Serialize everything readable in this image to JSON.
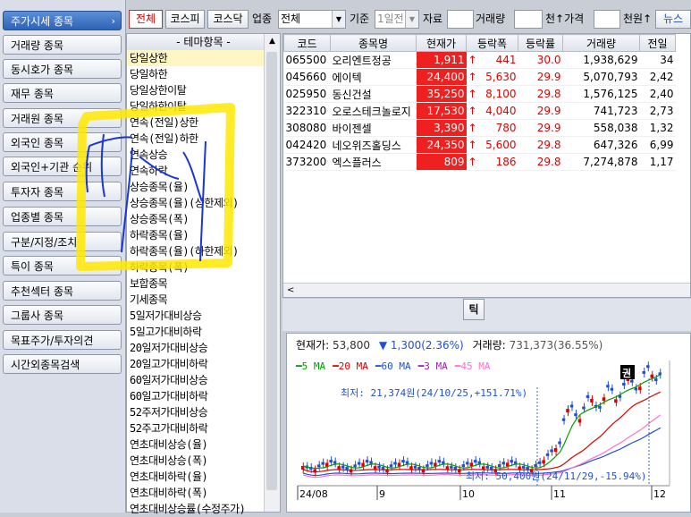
{
  "left_menu": [
    {
      "label": "주가시세 종목",
      "active": true
    },
    {
      "label": "거래량 종목"
    },
    {
      "label": "동시호가 종목"
    },
    {
      "label": "재무 종목"
    },
    {
      "label": "거래원 종목"
    },
    {
      "label": "외국인 종목"
    },
    {
      "label": "외국인+기관 순위"
    },
    {
      "label": "투자자 종목"
    },
    {
      "label": "업종별 종목"
    },
    {
      "label": "구분/지정/조치"
    },
    {
      "label": "특이 종목"
    },
    {
      "label": "추천섹터 종목"
    },
    {
      "label": "그룹사 종목"
    },
    {
      "label": "목표주가/투자의견"
    },
    {
      "label": "시간외종목검색"
    }
  ],
  "menu_arrow": "›",
  "toolbar": {
    "btn_all": "전체",
    "btn_kospi": "코스피",
    "btn_kosdaq": "코스닥",
    "sector_label": "업종",
    "sector_value": "전체",
    "basis_label": "기준",
    "basis_value": "1일전",
    "capital_label": "자료",
    "volume_label": "거래량",
    "volume_unit": "천↑가격",
    "price_unit": "천원↑",
    "news_label": "뉴스"
  },
  "theme": {
    "header": "- 테마항목 -",
    "items": [
      "당일상한",
      "당일하한",
      "당일상한이탈",
      "당일하한이탈",
      "연속(전일)상한",
      "연속(전일)하한",
      "연속상승",
      "연속하락",
      "상승종목(율)",
      "상승종목(율)(상한제외)",
      "상승종목(폭)",
      "하락종목(율)",
      "하락종목(율)(하한제외)",
      "하락종목(폭)",
      "보합종목",
      "기세종목",
      "5일저가대비상승",
      "5일고가대비하락",
      "20일저가대비상승",
      "20일고가대비하락",
      "60일저가대비상승",
      "60일고가대비하락",
      "52주저가대비상승",
      "52주고가대비하락",
      "연초대비상승(율)",
      "연초대비상승(폭)",
      "연초대비하락(율)",
      "연초대비하락(폭)",
      "연초대비상승률(수정주가)"
    ]
  },
  "table": {
    "headers": [
      "코드",
      "종목명",
      "현재가",
      "등락폭",
      "등락률",
      "거래량",
      "전일"
    ],
    "rows": [
      {
        "code": "065500",
        "name": "오리엔트정공",
        "price": "1,911",
        "change": "441",
        "rate": "30.0",
        "volume": "1,938,629",
        "prev": "34"
      },
      {
        "code": "045660",
        "name": "에이텍",
        "price": "24,400",
        "change": "5,630",
        "rate": "29.9",
        "volume": "5,070,793",
        "prev": "2,42"
      },
      {
        "code": "025950",
        "name": "동신건설",
        "price": "35,250",
        "change": "8,100",
        "rate": "29.8",
        "volume": "1,576,125",
        "prev": "2,40"
      },
      {
        "code": "322310",
        "name": "오로스테크놀로지",
        "price": "17,530",
        "change": "4,040",
        "rate": "29.9",
        "volume": "741,723",
        "prev": "2,73"
      },
      {
        "code": "308080",
        "name": "바이젠셀",
        "price": "3,390",
        "change": "780",
        "rate": "29.9",
        "volume": "558,038",
        "prev": "1,32"
      },
      {
        "code": "042420",
        "name": "네오위즈홀딩스",
        "price": "24,350",
        "change": "5,600",
        "rate": "29.8",
        "volume": "647,326",
        "prev": "6,99"
      },
      {
        "code": "373200",
        "name": "엑스플러스",
        "price": "809",
        "change": "186",
        "rate": "29.8",
        "volume": "7,274,878",
        "prev": "1,17"
      }
    ],
    "up_arrow": "↑"
  },
  "tick_label": "틱",
  "chart_info": {
    "price_label": "현재가:",
    "price": "53,800",
    "down_symbol": "▼",
    "change": "1,300(2.36%)",
    "volume_label": "거래량:",
    "volume": "731,373(36.55%)"
  },
  "chart_legend": [
    {
      "label": "5 MA",
      "color": "#00a000"
    },
    {
      "label": "20 MA",
      "color": "#e00000"
    },
    {
      "label": "60 MA",
      "color": "#2050d0"
    },
    {
      "label": "3 MA",
      "color": "#a020c0"
    },
    {
      "label": "45 MA",
      "color": "#ff70d0"
    }
  ],
  "chart_annotations": {
    "high": "최저: 21,374원(24/10/25,+151.71%)",
    "low": "최저: 50,400원(24/11/29,-15.94%)",
    "marker": "권"
  },
  "chart_data": {
    "type": "candlestick",
    "x_ticks": [
      "24/08",
      "9",
      "10",
      "11",
      "12"
    ],
    "series": [
      {
        "name": "5 MA"
      },
      {
        "name": "20 MA"
      },
      {
        "name": "60 MA"
      },
      {
        "name": "3 MA"
      },
      {
        "name": "45 MA"
      }
    ]
  },
  "colors": {
    "highlight": "#ffe000",
    "pen": "#1a35d8",
    "up": "#e00000",
    "down": "#2050d0"
  }
}
